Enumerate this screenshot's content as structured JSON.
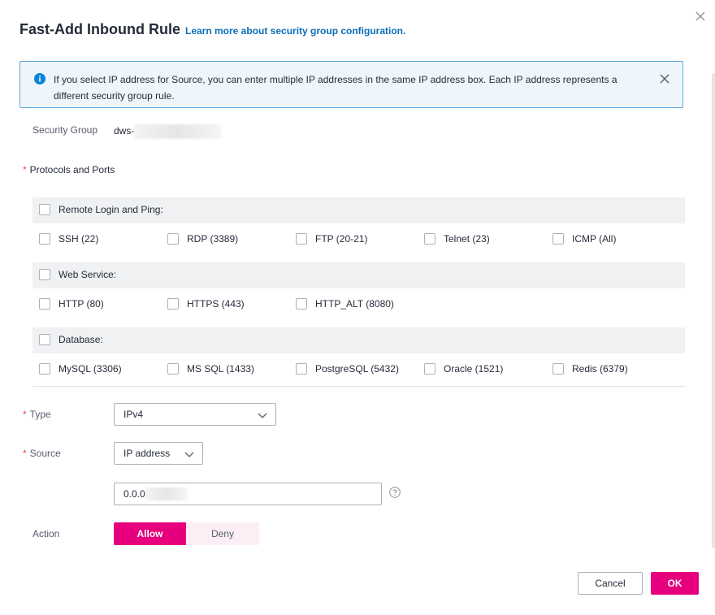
{
  "dialog": {
    "title": "Fast-Add Inbound Rule",
    "learn_more": "Learn more about security group configuration."
  },
  "info": {
    "text": "If you select IP address for Source, you can enter multiple IP addresses in the same IP address box. Each IP address represents a different security group rule."
  },
  "security_group": {
    "label": "Security Group",
    "value_prefix": "dws-"
  },
  "protocols": {
    "label": "Protocols and Ports",
    "groups": [
      {
        "title": "Remote Login and Ping:",
        "items": [
          "SSH (22)",
          "RDP (3389)",
          "FTP (20-21)",
          "Telnet (23)",
          "ICMP (All)"
        ]
      },
      {
        "title": "Web Service:",
        "items": [
          "HTTP (80)",
          "HTTPS (443)",
          "HTTP_ALT (8080)"
        ]
      },
      {
        "title": "Database:",
        "items": [
          "MySQL (3306)",
          "MS SQL (1433)",
          "PostgreSQL (5432)",
          "Oracle (1521)",
          "Redis (6379)"
        ]
      }
    ]
  },
  "type": {
    "label": "Type",
    "value": "IPv4"
  },
  "source": {
    "label": "Source",
    "value": "IP address",
    "ip_prefix": "0.0.0"
  },
  "action": {
    "label": "Action",
    "allow": "Allow",
    "deny": "Deny",
    "selected": "Allow"
  },
  "footer": {
    "cancel": "Cancel",
    "ok": "OK"
  },
  "colors": {
    "accent": "#e6007e",
    "link": "#0b6fb8",
    "info_border": "#5aa8df",
    "required": "#e54545"
  },
  "icons": [
    "close-icon",
    "info-icon",
    "chevron-down-icon",
    "help-circle-icon",
    "checkbox-icon"
  ]
}
